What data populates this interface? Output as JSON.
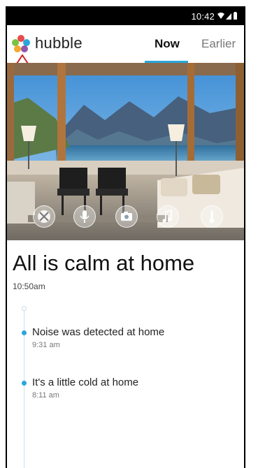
{
  "status_bar": {
    "time": "10:42"
  },
  "app": {
    "name": "hubble"
  },
  "tabs": [
    {
      "label": "Now",
      "selected": true
    },
    {
      "label": "Earlier",
      "selected": false
    }
  ],
  "camera": {
    "controls": [
      {
        "name": "mute-icon"
      },
      {
        "name": "microphone-icon"
      },
      {
        "name": "camera-icon"
      },
      {
        "name": "music-icon"
      },
      {
        "name": "thermometer-icon"
      }
    ]
  },
  "status": {
    "headline": "All is calm at home",
    "time": "10:50am"
  },
  "events": [
    {
      "title": "Noise was detected at home",
      "time": "9:31 am"
    },
    {
      "title": "It's a little cold at home",
      "time": "8:11 am"
    }
  ],
  "colors": {
    "accent": "#2aa6dc",
    "marker": "#d32020"
  }
}
